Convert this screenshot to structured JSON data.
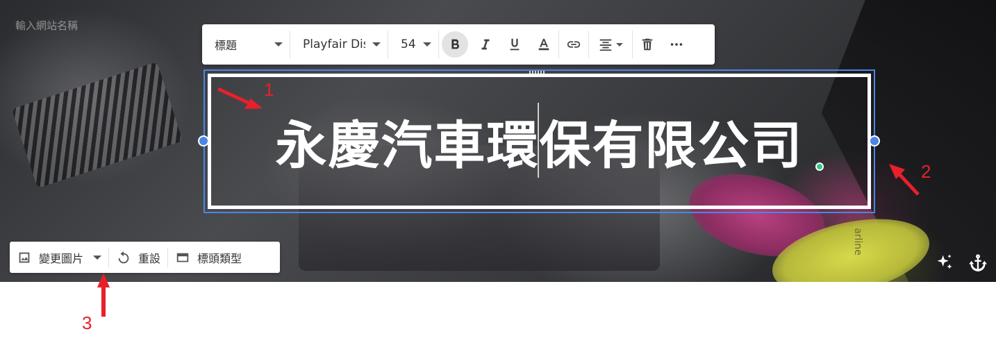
{
  "site": {
    "name_placeholder": "輸入網站名稱"
  },
  "toolbar": {
    "style_label": "標題",
    "font_label": "Playfair Display",
    "size_label": "54",
    "icons": [
      "bold-icon",
      "italic-icon",
      "underline-icon",
      "text-color-icon",
      "link-icon",
      "align-center-icon",
      "trash-icon",
      "more-icon"
    ]
  },
  "title": {
    "text_before": "永慶汽車環",
    "text_after": "保有限公司"
  },
  "header_toolbar": {
    "change_image_label": "變更圖片",
    "reset_label": "重設",
    "header_type_label": "標頭類型"
  },
  "banner": {
    "glove_text": "arline"
  },
  "annotations": {
    "one": "1",
    "two": "2",
    "three": "3",
    "color": "#e8202a"
  },
  "colors": {
    "selection": "#4a86e8",
    "handle": "#4a86e8"
  }
}
